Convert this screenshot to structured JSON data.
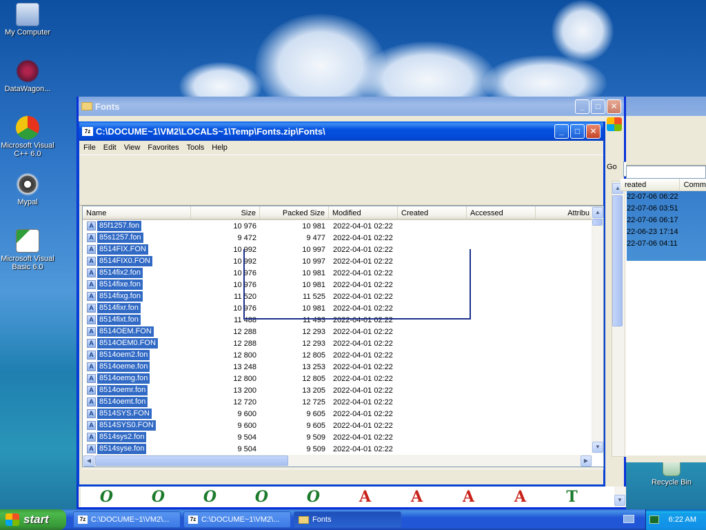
{
  "desktop": {
    "icons": [
      {
        "label": "My Computer"
      },
      {
        "label": "DataWagon..."
      },
      {
        "label": "Microsoft Visual C++ 6.0"
      },
      {
        "label": "Mypal"
      },
      {
        "label": "Microsoft Visual Basic 6.0"
      },
      {
        "label": "Recycle Bin"
      }
    ]
  },
  "back_window": {
    "title": "Fonts",
    "go_label": "Go",
    "columns": [
      "reated",
      "Comm"
    ],
    "created_dates": [
      "22-07-06 06:22",
      "22-07-06 03:51",
      "22-07-06 06:17",
      "22-06-23 17:14",
      "22-07-06 04:11"
    ],
    "thumbnails": [
      "O",
      "O",
      "O",
      "O",
      "O",
      "A",
      "A",
      "A",
      "A",
      "T"
    ]
  },
  "front_window": {
    "title": "C:\\DOCUME~1\\VM2\\LOCALS~1\\Temp\\Fonts.zip\\Fonts\\",
    "app_icon": "7z",
    "menu": [
      "File",
      "Edit",
      "View",
      "Favorites",
      "Tools",
      "Help"
    ],
    "columns": [
      "Name",
      "Size",
      "Packed Size",
      "Modified",
      "Created",
      "Accessed",
      "Attribu"
    ],
    "files": [
      {
        "name": "85f1257.fon",
        "size": "10 976",
        "packed": "10 981",
        "modified": "2022-04-01 02:22"
      },
      {
        "name": "85s1257.fon",
        "size": "9 472",
        "packed": "9 477",
        "modified": "2022-04-01 02:22"
      },
      {
        "name": "8514FIX.FON",
        "size": "10 992",
        "packed": "10 997",
        "modified": "2022-04-01 02:22"
      },
      {
        "name": "8514FIX0.FON",
        "size": "10 992",
        "packed": "10 997",
        "modified": "2022-04-01 02:22"
      },
      {
        "name": "8514fix2.fon",
        "size": "10 976",
        "packed": "10 981",
        "modified": "2022-04-01 02:22"
      },
      {
        "name": "8514fixe.fon",
        "size": "10 976",
        "packed": "10 981",
        "modified": "2022-04-01 02:22"
      },
      {
        "name": "8514fixg.fon",
        "size": "11 520",
        "packed": "11 525",
        "modified": "2022-04-01 02:22"
      },
      {
        "name": "8514fixr.fon",
        "size": "10 976",
        "packed": "10 981",
        "modified": "2022-04-01 02:22"
      },
      {
        "name": "8514fixt.fon",
        "size": "11 488",
        "packed": "11 493",
        "modified": "2022-04-01 02:22"
      },
      {
        "name": "8514OEM.FON",
        "size": "12 288",
        "packed": "12 293",
        "modified": "2022-04-01 02:22"
      },
      {
        "name": "8514OEM0.FON",
        "size": "12 288",
        "packed": "12 293",
        "modified": "2022-04-01 02:22"
      },
      {
        "name": "8514oem2.fon",
        "size": "12 800",
        "packed": "12 805",
        "modified": "2022-04-01 02:22"
      },
      {
        "name": "8514oeme.fon",
        "size": "13 248",
        "packed": "13 253",
        "modified": "2022-04-01 02:22"
      },
      {
        "name": "8514oemg.fon",
        "size": "12 800",
        "packed": "12 805",
        "modified": "2022-04-01 02:22"
      },
      {
        "name": "8514oemr.fon",
        "size": "13 200",
        "packed": "13 205",
        "modified": "2022-04-01 02:22"
      },
      {
        "name": "8514oemt.fon",
        "size": "12 720",
        "packed": "12 725",
        "modified": "2022-04-01 02:22"
      },
      {
        "name": "8514SYS.FON",
        "size": "9 600",
        "packed": "9 605",
        "modified": "2022-04-01 02:22"
      },
      {
        "name": "8514SYS0.FON",
        "size": "9 600",
        "packed": "9 605",
        "modified": "2022-04-01 02:22"
      },
      {
        "name": "8514sys2.fon",
        "size": "9 504",
        "packed": "9 509",
        "modified": "2022-04-01 02:22"
      },
      {
        "name": "8514syse.fon",
        "size": "9 504",
        "packed": "9 509",
        "modified": "2022-04-01 02:22"
      }
    ]
  },
  "taskbar": {
    "start_label": "start",
    "tasks": [
      {
        "label": "C:\\DOCUME~1\\VM2\\...",
        "icon": "7z"
      },
      {
        "label": "C:\\DOCUME~1\\VM2\\...",
        "icon": "7z"
      },
      {
        "label": "Fonts",
        "icon": "folder-icon"
      }
    ],
    "clock": "6:22 AM"
  }
}
